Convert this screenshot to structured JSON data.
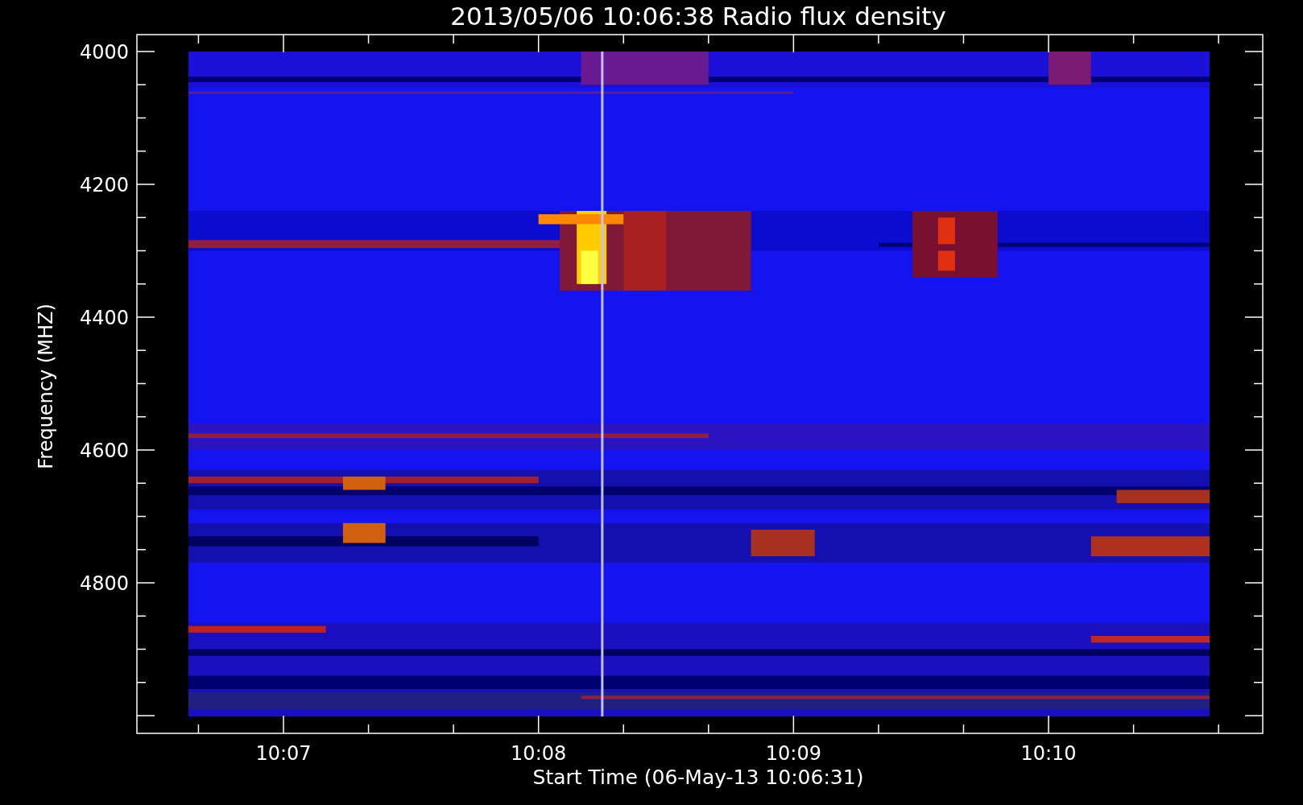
{
  "title": "2013/05/06 10:06:38 Radio flux density",
  "ylabel": "Frequency (MHZ)",
  "xlabel": "Start Time (06-May-13 10:06:31)",
  "yticks": [
    "4000",
    "4200",
    "4400",
    "4600",
    "4800"
  ],
  "xticks": [
    "10:07",
    "10:08",
    "10:09",
    "10:10"
  ]
}
